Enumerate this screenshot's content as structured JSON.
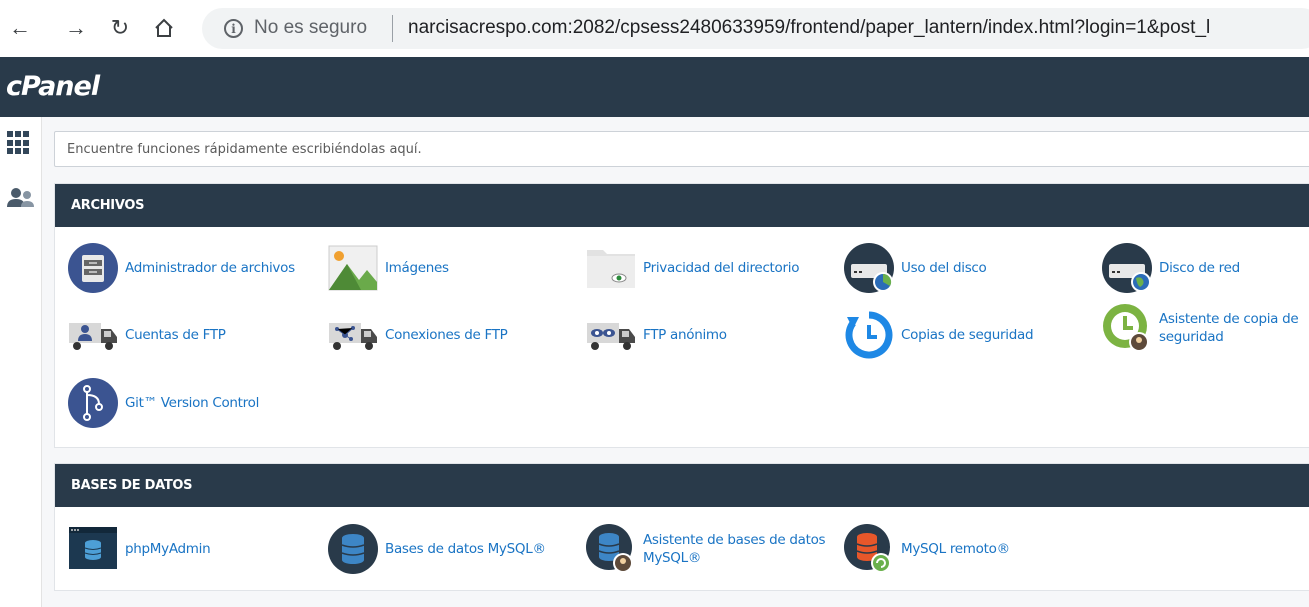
{
  "browser": {
    "security_label": "No es seguro",
    "url": "narcisacrespo.com:2082/cpsess2480633959/frontend/paper_lantern/index.html?login=1&post_l"
  },
  "app": {
    "logo": "cPanel"
  },
  "search": {
    "placeholder": "Encuentre funciones rápidamente escribiéndolas aquí."
  },
  "sections": [
    {
      "title": "ARCHIVOS",
      "items": [
        {
          "label": "Administrador de archivos",
          "icon": "file-manager-icon"
        },
        {
          "label": "Imágenes",
          "icon": "images-icon"
        },
        {
          "label": "Privacidad del directorio",
          "icon": "directory-privacy-icon"
        },
        {
          "label": "Uso del disco",
          "icon": "disk-usage-icon"
        },
        {
          "label": "Disco de red",
          "icon": "web-disk-icon"
        },
        {
          "label": "Cuentas de FTP",
          "icon": "ftp-accounts-icon"
        },
        {
          "label": "Conexiones de FTP",
          "icon": "ftp-connections-icon"
        },
        {
          "label": "FTP anónimo",
          "icon": "anonymous-ftp-icon"
        },
        {
          "label": "Copias de seguridad",
          "icon": "backup-icon"
        },
        {
          "label": "Asistente de copia de seguridad",
          "icon": "backup-wizard-icon"
        },
        {
          "label": "Git™ Version Control",
          "icon": "git-icon"
        }
      ]
    },
    {
      "title": "BASES DE DATOS",
      "items": [
        {
          "label": "phpMyAdmin",
          "icon": "phpmyadmin-icon"
        },
        {
          "label": "Bases de datos MySQL®",
          "icon": "mysql-databases-icon"
        },
        {
          "label": "Asistente de bases de datos MySQL®",
          "icon": "mysql-wizard-icon"
        },
        {
          "label": "MySQL remoto®",
          "icon": "remote-mysql-icon"
        }
      ]
    }
  ]
}
